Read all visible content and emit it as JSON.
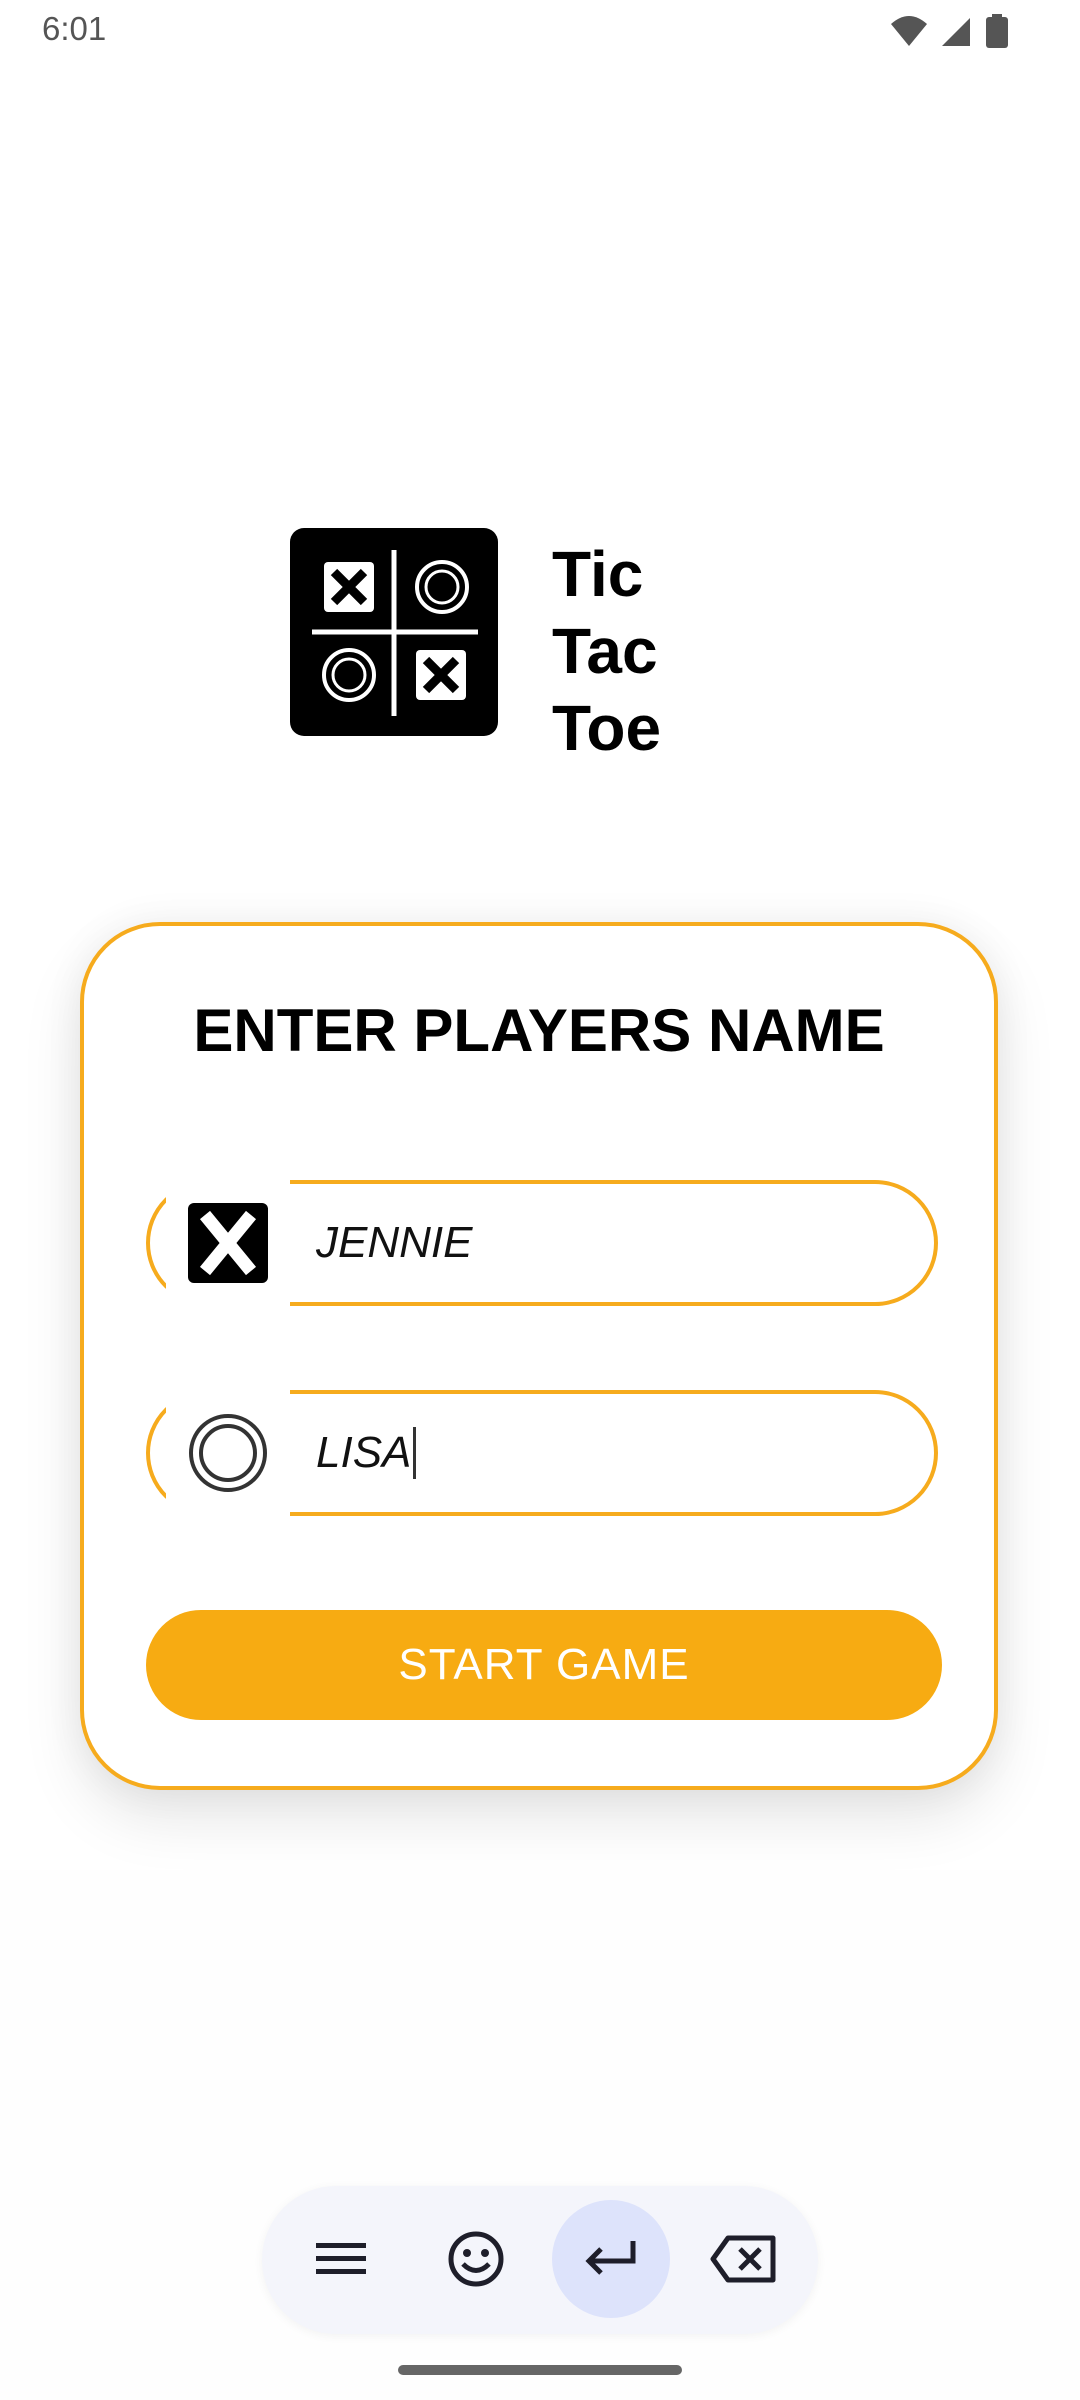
{
  "status_bar": {
    "time": "6:01"
  },
  "app": {
    "title_lines": [
      "Tic",
      "Tac",
      "Toe"
    ]
  },
  "form": {
    "heading": "ENTER PLAYERS NAME",
    "player_x": {
      "value": "JENNIE",
      "icon": "x-mark-icon"
    },
    "player_o": {
      "value": "LISA",
      "icon": "o-mark-icon"
    },
    "start_label": "START GAME"
  },
  "colors": {
    "accent": "#f6ab1d",
    "button": "#f7ab12"
  },
  "keyboard_toolbar": {
    "icons": [
      "menu-icon",
      "emoji-icon",
      "enter-icon",
      "backspace-icon"
    ]
  }
}
